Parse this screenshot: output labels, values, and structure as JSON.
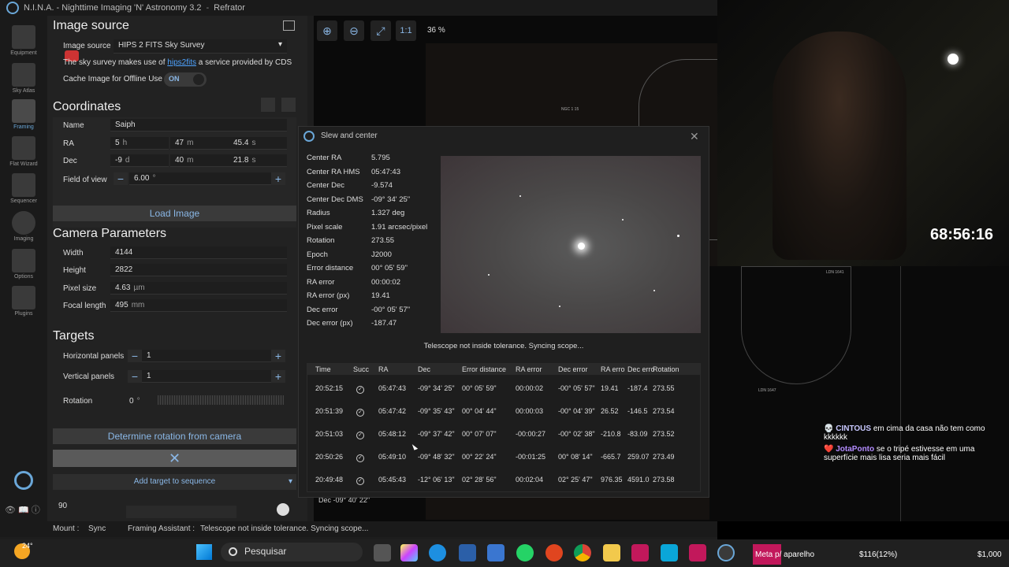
{
  "app": {
    "title": "N.I.N.A. - Nighttime Imaging 'N' Astronomy 3.2",
    "profile": "Refrator"
  },
  "sidebar": {
    "items": [
      {
        "label": "Equipment"
      },
      {
        "label": "Sky Atlas"
      },
      {
        "label": "Framing"
      },
      {
        "label": "Flat Wizard"
      },
      {
        "label": "Sequencer"
      },
      {
        "label": "Imaging"
      },
      {
        "label": "Options"
      },
      {
        "label": "Plugins"
      }
    ]
  },
  "image_source": {
    "heading": "Image source",
    "label": "Image source",
    "selected": "HIPS 2 FITS Sky Survey",
    "note_pre": "The sky survey makes use of ",
    "note_link": "hips2fits",
    "note_post": " a service provided by CDS",
    "cache_label": "Cache Image for Offline Use",
    "cache_state": "ON"
  },
  "coordinates": {
    "heading": "Coordinates",
    "name_label": "Name",
    "name": "Saiph",
    "ra_label": "RA",
    "ra_h": "5",
    "ra_h_unit": "h",
    "ra_m": "47",
    "ra_m_unit": "m",
    "ra_s": "45.4",
    "ra_s_unit": "s",
    "dec_label": "Dec",
    "dec_d": "-9",
    "dec_d_unit": "d",
    "dec_m": "40",
    "dec_m_unit": "m",
    "dec_s": "21.8",
    "dec_s_unit": "s",
    "fov_label": "Field of view",
    "fov": "6.00",
    "fov_unit": "°",
    "load_button": "Load Image"
  },
  "camera": {
    "heading": "Camera Parameters",
    "width_label": "Width",
    "width": "4144",
    "height_label": "Height",
    "height": "2822",
    "pixel_label": "Pixel size",
    "pixel": "4.63",
    "pixel_unit": "µm",
    "focal_label": "Focal length",
    "focal": "495",
    "focal_unit": "mm"
  },
  "targets": {
    "heading": "Targets",
    "hpanels_label": "Horizontal panels",
    "hpanels": "1",
    "vpanels_label": "Vertical panels",
    "vpanels": "1",
    "rotation_label": "Rotation",
    "rotation": "0",
    "rotation_unit": "°",
    "determine_button": "Determine rotation from camera",
    "add_button": "Add target to sequence",
    "misc_value": "90"
  },
  "toolbar": {
    "one_to_one": "1:1",
    "zoom": "36 %"
  },
  "dialog": {
    "title": "Slew and center",
    "fields": [
      {
        "label": "Center RA",
        "value": "5.795"
      },
      {
        "label": "Center RA HMS",
        "value": "05:47:43"
      },
      {
        "label": "Center Dec",
        "value": "-9.574"
      },
      {
        "label": "Center Dec DMS",
        "value": "-09° 34' 25\""
      },
      {
        "label": "Radius",
        "value": "1.327 deg"
      },
      {
        "label": "Pixel scale",
        "value": "1.91 arcsec/pixel"
      },
      {
        "label": "Rotation",
        "value": "273.55"
      },
      {
        "label": "Epoch",
        "value": "J2000"
      },
      {
        "label": "Error distance",
        "value": "00° 05' 59\""
      },
      {
        "label": "RA error",
        "value": "00:00:02"
      },
      {
        "label": "RA error (px)",
        "value": "19.41"
      },
      {
        "label": "Dec error",
        "value": "-00° 05' 57\""
      },
      {
        "label": "Dec error (px)",
        "value": "-187.47"
      }
    ],
    "message": "Telescope not inside tolerance. Syncing scope...",
    "columns": [
      "Time",
      "Succ",
      "RA",
      "Dec",
      "Error distance",
      "RA error",
      "Dec error",
      "RA erro",
      "Dec erro",
      "Rotation"
    ],
    "rows": [
      [
        "20:52:15",
        "✓",
        "05:47:43",
        "-09° 34' 25\"",
        "00° 05' 59\"",
        "00:00:02",
        "-00° 05' 57\"",
        "19.41",
        "-187.4",
        "273.55"
      ],
      [
        "20:51:39",
        "✓",
        "05:47:42",
        "-09° 35' 43\"",
        "00° 04' 44\"",
        "00:00:03",
        "-00° 04' 39\"",
        "26.52",
        "-146.5",
        "273.54"
      ],
      [
        "20:51:03",
        "✓",
        "05:48:12",
        "-09° 37' 42\"",
        "00° 07' 07\"",
        "-00:00:27",
        "-00° 02' 38\"",
        "-210.8",
        "-83.09",
        "273.52"
      ],
      [
        "20:50:26",
        "✓",
        "05:49:10",
        "-09° 48' 32\"",
        "00° 22' 24\"",
        "-00:01:25",
        "00° 08' 14\"",
        "-665.7",
        "259.07",
        "273.49"
      ],
      [
        "20:49:48",
        "✓",
        "05:45:43",
        "-12° 06' 13\"",
        "02° 28' 56\"",
        "00:02:04",
        "02° 25' 47\"",
        "976.35",
        "4591.0",
        "273.58"
      ]
    ]
  },
  "map_labels": {
    "dec_label": "Dec -09° 40' 22\"",
    "ngc": "NGC 1 15",
    "ldn1": "LDN 1641",
    "ldn2": "LDN 1647"
  },
  "status": {
    "mount": "Mount :",
    "mount_value": "Sync",
    "assistant": "Framing Assistant :",
    "assistant_value": "Telescope not inside tolerance. Syncing scope..."
  },
  "overlay": {
    "timer": "68:56:16"
  },
  "chat": [
    {
      "user": "CINTOUS",
      "text": "em cima da casa não tem como kkkkkk"
    },
    {
      "user": "JotaPonto",
      "text": "se o tripé estivesse em uma superfície mais lisa seria mais fácil"
    }
  ],
  "taskbar": {
    "weather": "24°",
    "search": "Pesquisar",
    "meta": "Meta p/ aparelho",
    "stat1": "$116(12%)",
    "stat2": "$1,000"
  }
}
